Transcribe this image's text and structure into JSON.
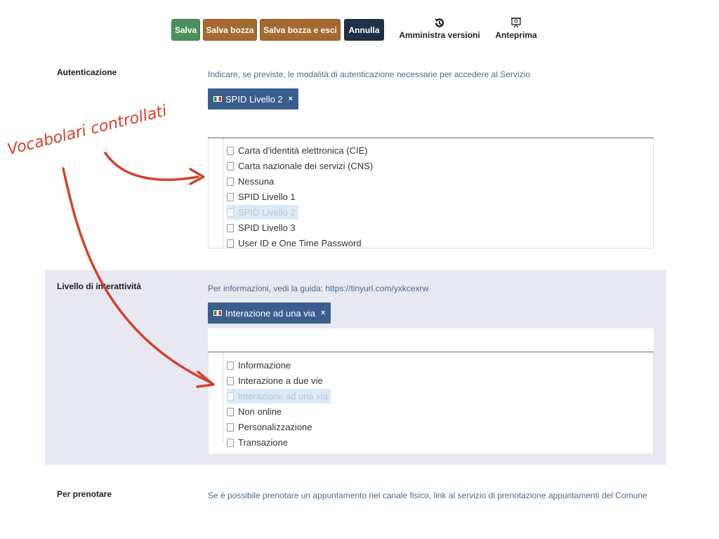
{
  "toolbar": {
    "salva": "Salva",
    "salva_bozza": "Salva bozza",
    "salva_bozza_esci": "Salva bozza e esci",
    "annulla": "Annulla",
    "amministra_versioni": "Amministra versioni",
    "anteprima": "Anteprima",
    "icons": {
      "versioni": "history-icon",
      "anteprima": "presentation-icon"
    },
    "colors": {
      "salva": "#4d8f5c",
      "bozza": "#a46a31",
      "annulla": "#1f3149"
    }
  },
  "annotation": {
    "text": "Vocabolari controllati",
    "color": "#d2422d"
  },
  "autenticazione": {
    "label": "Autenticazione",
    "help": "Indicare, se previste, le modalità di autenticazione necessarie per accedere al Servizio",
    "selected_tag": "SPID Livello 2",
    "options": [
      "Carta d'identità elettronica (CIE)",
      "Carta nazionale dei servizi (CNS)",
      "Nessuna",
      "SPID Livello 1",
      "SPID Livello 2",
      "SPID Livello 3",
      "User ID e One Time Password"
    ]
  },
  "livello": {
    "label": "Livello di interattività",
    "help": "Per informazioni, vedi la guida: https://tinyurl.com/yxkcexrw",
    "selected_tag": "Interazione ad una via",
    "options": [
      "Informazione",
      "Interazione a due vie",
      "Interazione ad una via",
      "Non online",
      "Personalizzazione",
      "Transazione"
    ]
  },
  "prenotare": {
    "label": "Per prenotare",
    "help": "Se è possibile prenotare un appuntamento nel canale fisico, link al servizio di prenotazione appuntamenti del Comune"
  },
  "tag_close_symbol": "×"
}
